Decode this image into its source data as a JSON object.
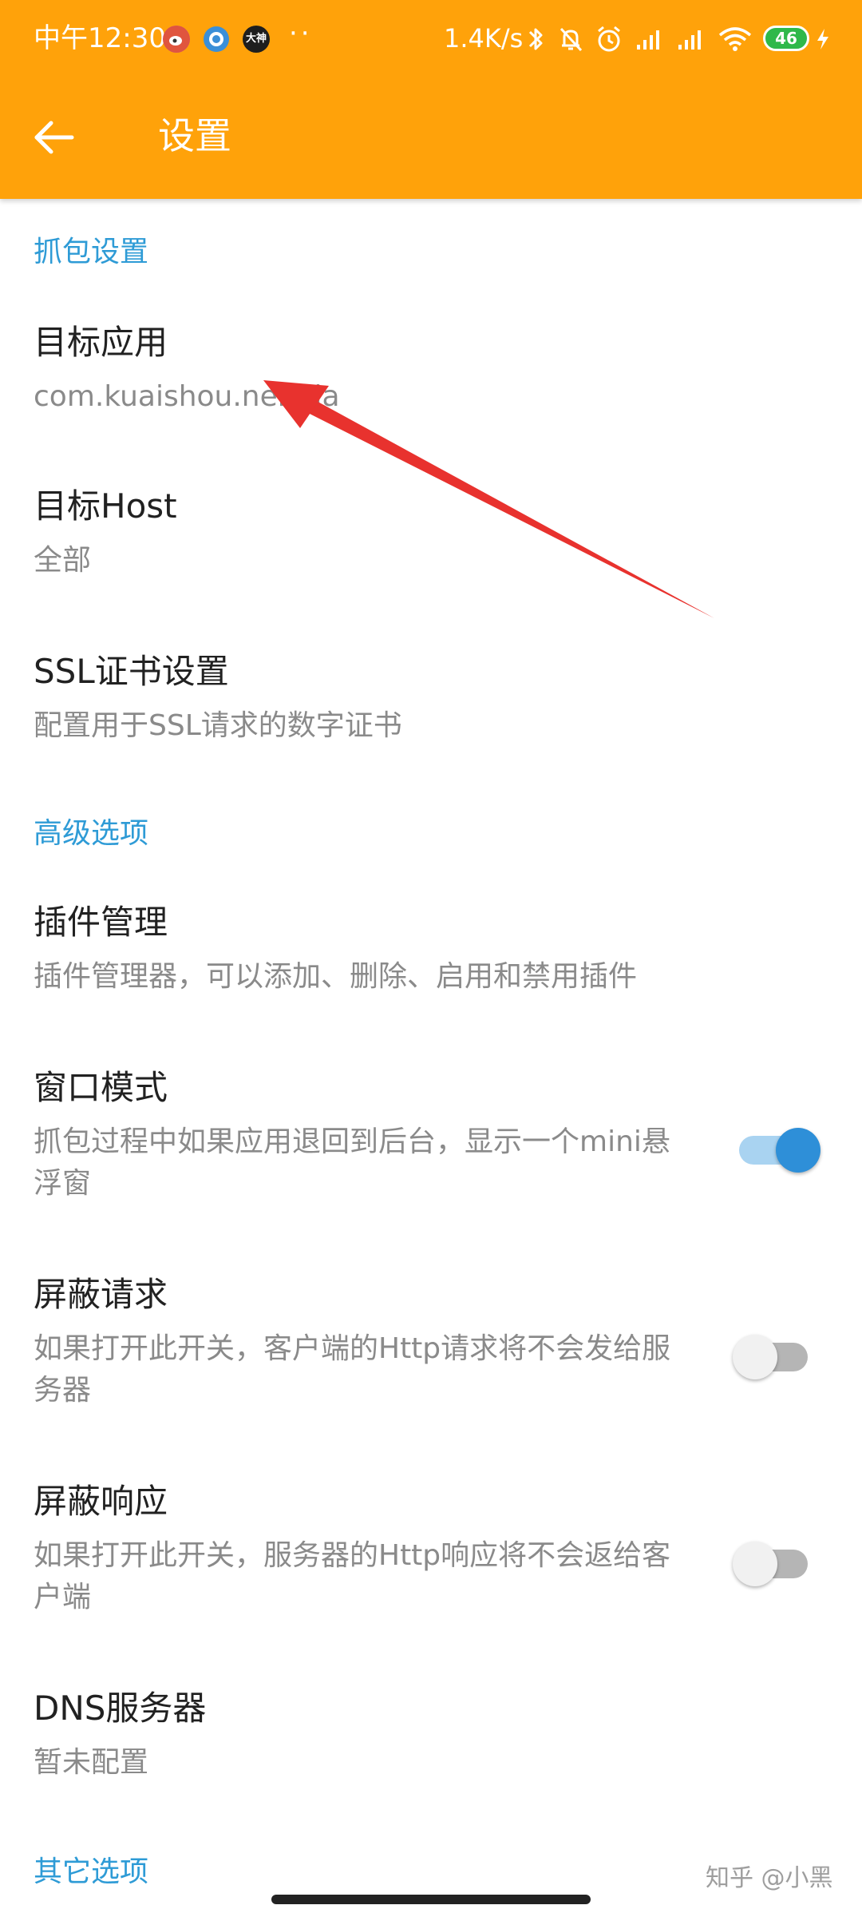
{
  "colors": {
    "toolbar": "#FFA20A",
    "section_header": "#2E9BD6",
    "title_text": "#212121",
    "summary_text": "#8A8A8A",
    "switch_on": "#2E8FD8",
    "switch_off_track": "#B5B5B5",
    "annotation_arrow": "#E8322E"
  },
  "status_bar": {
    "time": "中午12:30",
    "dots": "··",
    "network_speed": "1.4K/s",
    "battery": "46",
    "notification_icons": [
      "weibo-icon",
      "chat-bubble-icon",
      "dashen-app-icon"
    ],
    "notification_dashen_label": "大神",
    "system_icons": [
      "bluetooth-icon",
      "mute-icon",
      "alarm-icon",
      "signal-icon",
      "signal-icon",
      "wifi-icon",
      "battery-icon",
      "charging-icon"
    ]
  },
  "toolbar": {
    "back_icon": "arrow-left-icon",
    "title": "设置"
  },
  "sections": {
    "capture": {
      "header": "抓包设置",
      "target_app": {
        "title": "目标应用",
        "summary": "com.kuaishou.nebula"
      },
      "target_host": {
        "title": "目标Host",
        "summary": "全部"
      },
      "ssl": {
        "title": "SSL证书设置",
        "summary": "配置用于SSL请求的数字证书"
      }
    },
    "advanced": {
      "header": "高级选项",
      "plugins": {
        "title": "插件管理",
        "summary": "插件管理器，可以添加、删除、启用和禁用插件"
      },
      "window_mode": {
        "title": "窗口模式",
        "summary": "抓包过程中如果应用退回到后台，显示一个mini悬浮窗",
        "enabled": true
      },
      "block_request": {
        "title": "屏蔽请求",
        "summary": "如果打开此开关，客户端的Http请求将不会发给服务器",
        "enabled": false
      },
      "block_response": {
        "title": "屏蔽响应",
        "summary": "如果打开此开关，服务器的Http响应将不会返给客户端",
        "enabled": false
      },
      "dns": {
        "title": "DNS服务器",
        "summary": "暂未配置"
      }
    },
    "other": {
      "header": "其它选项"
    }
  },
  "watermark": "知乎 @小黑"
}
